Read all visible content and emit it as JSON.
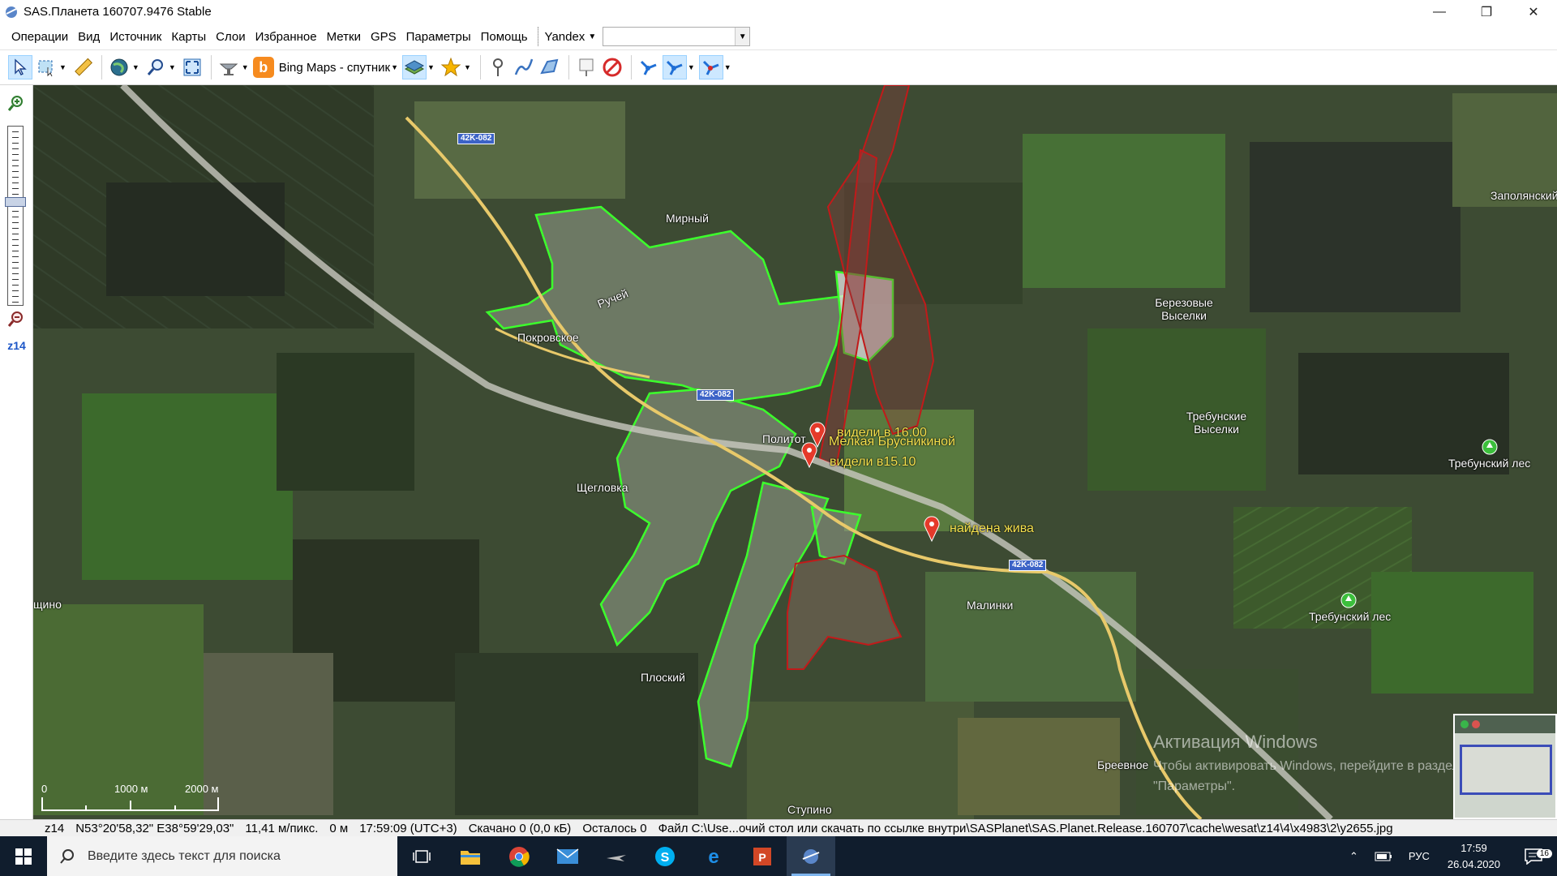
{
  "titlebar": {
    "title": "SAS.Планета 160707.9476 Stable",
    "minimize": "—",
    "maximize": "❐",
    "close": "✕"
  },
  "menu": {
    "items": [
      "Операции",
      "Вид",
      "Источник",
      "Карты",
      "Слои",
      "Избранное",
      "Метки",
      "GPS",
      "Параметры",
      "Помощь"
    ],
    "search_provider": "Yandex",
    "search_value": ""
  },
  "toolbar": {
    "map_type": "Bing Maps - спутник",
    "icons": [
      "pointer-icon",
      "select-area-icon",
      "ruler-icon",
      "globe-icon",
      "zoom-icon",
      "fullscreen-icon",
      "satellite-icon",
      "bing-icon",
      "layers-icon",
      "favorites-star-icon",
      "placemark-icon",
      "path-icon",
      "polygon-icon",
      "marks-list-icon",
      "delete-marks-icon",
      "gps-icon",
      "gps-track-icon",
      "gps-follow-icon"
    ]
  },
  "zoom": {
    "level_label": "z14"
  },
  "map": {
    "places": [
      {
        "name": "Мирный"
      },
      {
        "name": "Ручей"
      },
      {
        "name": "Покровское"
      },
      {
        "name": "Политот"
      },
      {
        "name": "Щегловка"
      },
      {
        "name": "Плоский"
      },
      {
        "name": "Малинки"
      },
      {
        "name": "Березовые Выселки"
      },
      {
        "name": "Требунские Выселки"
      },
      {
        "name": "Требунский лес"
      },
      {
        "name": "Требунский лес"
      },
      {
        "name": "Заполянский"
      },
      {
        "name": "щино"
      },
      {
        "name": "Бреевное"
      },
      {
        "name": "Ступино"
      }
    ],
    "roads": [
      "42K-082",
      "42K-082",
      "42K-082"
    ],
    "marks": [
      {
        "label": "видели в 16.00"
      },
      {
        "label": "Мелкая Брусникиной"
      },
      {
        "label": "видели в15.10"
      },
      {
        "label": "найдена жива"
      }
    ],
    "scale": {
      "zero": "0",
      "mid": "1000 м",
      "end": "2000 м"
    },
    "activation": {
      "title": "Активация Windows",
      "line1": "Чтобы активировать Windows, перейдите в раздел",
      "line2": "\"Параметры\"."
    }
  },
  "statusbar": {
    "zoom": "z14",
    "coords": "N53°20'58,32\" E38°59'29,03\"",
    "resolution": "11,41 м/пикс.",
    "distance": "0 м",
    "time": "17:59:09 (UTC+3)",
    "downloaded": "Скачано 0 (0,0 кБ)",
    "remaining": "Осталось 0",
    "file": "Файл C:\\Use...очий стол или скачать по ссылке внутри\\SASPlanet\\SAS.Planet.Release.160707\\cache\\wesat\\z14\\4\\x4983\\2\\y2655.jpg"
  },
  "taskbar": {
    "search_placeholder": "Введите здесь текст для поиска",
    "lang": "РУС",
    "time": "17:59",
    "date": "26.04.2020",
    "notifications": "16"
  }
}
